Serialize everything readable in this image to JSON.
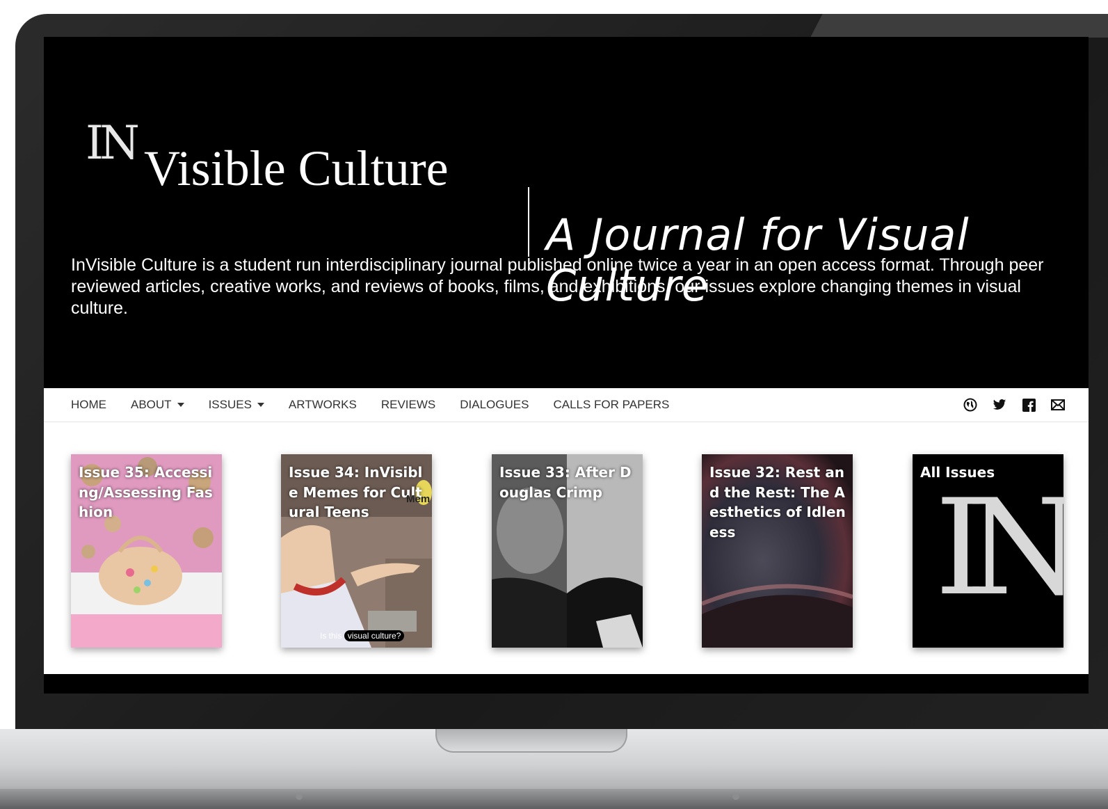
{
  "hero": {
    "logo_mark": "IN",
    "wordmark": "Visible Culture",
    "tagline": "A Journal for Visual Culture",
    "intro": "InVisible Culture is a student run interdisciplinary journal published online twice a year in an open access format. Through peer reviewed articles, creative works, and reviews of books, films, and exhibitions, our issues explore changing themes in visual culture."
  },
  "nav": {
    "items": [
      {
        "label": "HOME",
        "dropdown": false
      },
      {
        "label": "ABOUT",
        "dropdown": true
      },
      {
        "label": "ISSUES",
        "dropdown": true
      },
      {
        "label": "ARTWORKS",
        "dropdown": false
      },
      {
        "label": "REVIEWS",
        "dropdown": false
      },
      {
        "label": "DIALOGUES",
        "dropdown": false
      },
      {
        "label": "CALLS FOR PAPERS",
        "dropdown": false
      }
    ],
    "social_icons": [
      "globe-icon",
      "twitter-icon",
      "facebook-icon",
      "mail-icon"
    ]
  },
  "issues": [
    {
      "title": "Issue 35: Accessing/Assessing Fashion"
    },
    {
      "title": "Issue 34: InVisible Memes for Cultural Teens",
      "caption_plain": "Is this",
      "caption_pill": "visual culture?",
      "meme_text": "Mem"
    },
    {
      "title": "Issue 33: After Douglas Crimp"
    },
    {
      "title": "Issue 32: Rest and the Rest: The Aesthetics of Idleness"
    },
    {
      "title": "All Issues",
      "logo": "IN"
    }
  ],
  "colors": {
    "background": "#000000",
    "nav_text": "#333333",
    "card_text": "#ffffff"
  }
}
